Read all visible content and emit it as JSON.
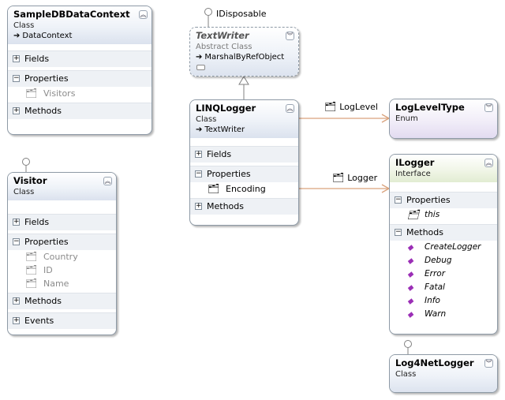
{
  "shapes": {
    "sampledb": {
      "title": "SampleDBDataContext",
      "kind": "Class",
      "base": "DataContext",
      "sections": {
        "fields": "Fields",
        "properties": "Properties",
        "methods": "Methods"
      },
      "properties": [
        "Visitors"
      ]
    },
    "visitor": {
      "title": "Visitor",
      "kind": "Class",
      "sections": {
        "fields": "Fields",
        "properties": "Properties",
        "methods": "Methods",
        "events": "Events"
      },
      "properties": [
        "Country",
        "ID",
        "Name"
      ]
    },
    "textwriter": {
      "title": "TextWriter",
      "kind": "Abstract Class",
      "base": "MarshalByRefObject"
    },
    "linqlogger": {
      "title": "LINQLogger",
      "kind": "Class",
      "base": "TextWriter",
      "sections": {
        "fields": "Fields",
        "properties": "Properties",
        "methods": "Methods"
      },
      "properties": [
        "Encoding"
      ]
    },
    "logleveltype": {
      "title": "LogLevelType",
      "kind": "Enum"
    },
    "ilogger": {
      "title": "ILogger",
      "kind": "Interface",
      "sections": {
        "properties": "Properties",
        "methods": "Methods"
      },
      "properties": [
        "this"
      ],
      "methods": [
        "CreateLogger",
        "Debug",
        "Error",
        "Fatal",
        "Info",
        "Warn"
      ]
    },
    "log4net": {
      "title": "Log4NetLogger",
      "kind": "Class"
    }
  },
  "labels": {
    "idisposable": "IDisposable",
    "loglevel": "LogLevel",
    "logger": "Logger"
  },
  "icons": {
    "collapse": "double-chevron-up-icon",
    "expand": "double-chevron-down-icon",
    "property": "property-icon",
    "method": "method-icon",
    "inherit": "inheritance-arrow-icon"
  },
  "colors": {
    "association": "#d9a27c",
    "lines": "#808080",
    "border": "#8e9aa6"
  }
}
